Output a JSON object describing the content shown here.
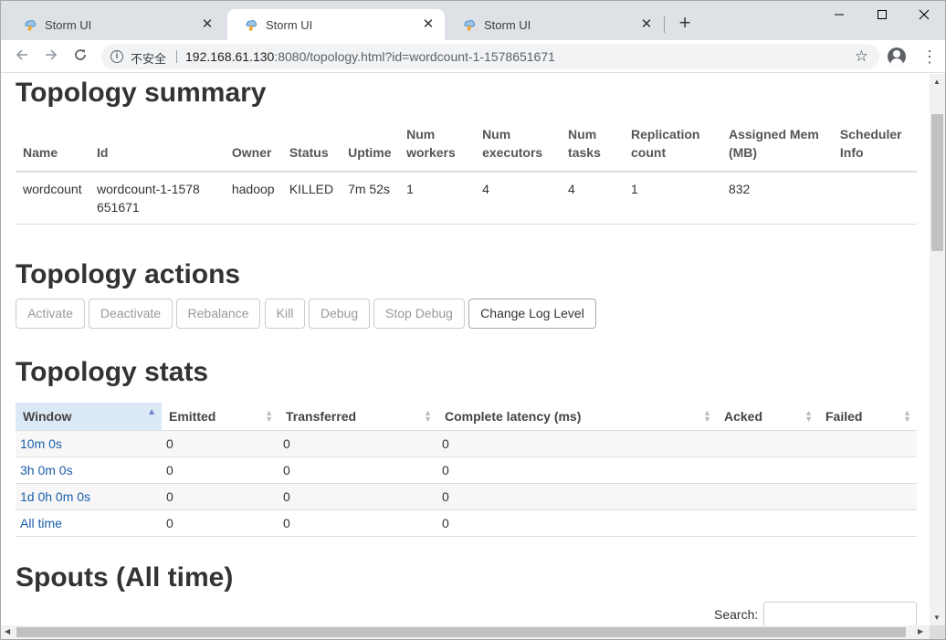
{
  "browser": {
    "tabs": [
      {
        "title": "Storm UI",
        "active": false
      },
      {
        "title": "Storm UI",
        "active": true
      },
      {
        "title": "Storm UI",
        "active": false
      }
    ],
    "tab_close_glyph": "✕",
    "new_tab_glyph": "+",
    "window_controls": {
      "minimize": "—",
      "maximize": "☐",
      "close": "✕"
    },
    "security_label": "不安全",
    "url_host": "192.168.61.130",
    "url_rest": ":8080/topology.html?id=wordcount-1-1578651671",
    "icons": {
      "back": "arrow-left",
      "forward": "arrow-right",
      "reload": "reload",
      "bookmark": "star-outline",
      "profile": "account-circle",
      "menu": "more-vert"
    }
  },
  "summary": {
    "heading": "Topology summary",
    "columns": [
      "Name",
      "Id",
      "Owner",
      "Status",
      "Uptime",
      "Num workers",
      "Num executors",
      "Num tasks",
      "Replication count",
      "Assigned Mem (MB)",
      "Scheduler Info"
    ],
    "row": {
      "name": "wordcount",
      "id": "wordcount-1-1578651671",
      "owner": "hadoop",
      "status": "KILLED",
      "uptime": "7m 52s",
      "num_workers": "1",
      "num_executors": "4",
      "num_tasks": "4",
      "replication_count": "1",
      "assigned_mem": "832",
      "scheduler_info": ""
    }
  },
  "actions": {
    "heading": "Topology actions",
    "buttons": [
      {
        "label": "Activate",
        "enabled": false
      },
      {
        "label": "Deactivate",
        "enabled": false
      },
      {
        "label": "Rebalance",
        "enabled": false
      },
      {
        "label": "Kill",
        "enabled": false
      },
      {
        "label": "Debug",
        "enabled": false
      },
      {
        "label": "Stop Debug",
        "enabled": false
      },
      {
        "label": "Change Log Level",
        "enabled": true
      }
    ]
  },
  "stats": {
    "heading": "Topology stats",
    "columns": [
      "Window",
      "Emitted",
      "Transferred",
      "Complete latency (ms)",
      "Acked",
      "Failed"
    ],
    "sorted_column": "Window",
    "rows": [
      {
        "window": "10m 0s",
        "emitted": "0",
        "transferred": "0",
        "latency": "0",
        "acked": "",
        "failed": ""
      },
      {
        "window": "3h 0m 0s",
        "emitted": "0",
        "transferred": "0",
        "latency": "0",
        "acked": "",
        "failed": ""
      },
      {
        "window": "1d 0h 0m 0s",
        "emitted": "0",
        "transferred": "0",
        "latency": "0",
        "acked": "",
        "failed": ""
      },
      {
        "window": "All time",
        "emitted": "0",
        "transferred": "0",
        "latency": "0",
        "acked": "",
        "failed": ""
      }
    ]
  },
  "spouts": {
    "heading": "Spouts (All time)",
    "search_label": "Search:",
    "search_value": ""
  }
}
